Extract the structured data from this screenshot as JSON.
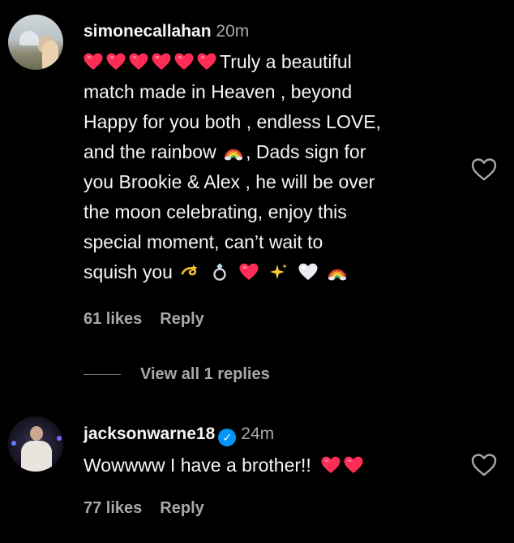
{
  "comments": [
    {
      "username": "simonecallahan",
      "time": "20m",
      "text_lines": [
        "Truly a beautiful",
        "match made in Heaven , beyond",
        "Happy for you both , endless LOVE,",
        "and the rainbow",
        ", Dads sign for",
        "you Brookie & Alex , he will be over",
        "the moon celebrating, enjoy this",
        "special moment, can’t wait to",
        "squish you"
      ],
      "likes": "61 likes",
      "reply": "Reply",
      "view_replies": "View all 1 replies"
    },
    {
      "username": "jacksonwarne18",
      "verified_icon": "verified-badge-icon",
      "time": "24m",
      "text": "Wowwww I have a brother!!",
      "likes": "77 likes",
      "reply": "Reply"
    }
  ],
  "colors": {
    "background": "#000000",
    "text": "#f5f5f5",
    "muted": "#a8a8a8",
    "heart": "#ff2d55",
    "verified": "#0095f6"
  }
}
